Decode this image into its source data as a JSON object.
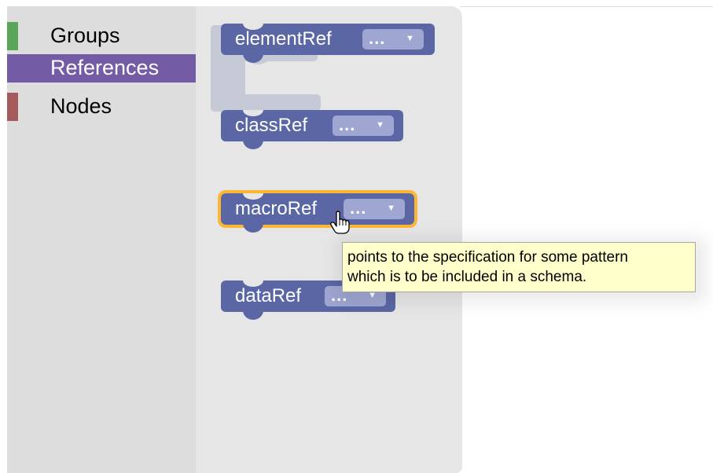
{
  "toolbox": {
    "categories": [
      {
        "label": "Groups",
        "color": "#5ba55b"
      },
      {
        "label": "References",
        "color": "#745ba5"
      },
      {
        "label": "Nodes",
        "color": "#a55b5b"
      }
    ],
    "selected": "References"
  },
  "flyout": {
    "blocks": [
      {
        "name": "elementRef",
        "value": "...",
        "dropdown_icon": "triangle-down-icon",
        "color": "#5b67a5"
      },
      {
        "name": "classRef",
        "value": "...",
        "dropdown_icon": "triangle-down-icon",
        "color": "#5b67a5"
      },
      {
        "name": "macroRef",
        "value": "...",
        "dropdown_icon": "triangle-down-icon",
        "color": "#5b67a5",
        "highlight": "#fbb732"
      },
      {
        "name": "dataRef",
        "value": "...",
        "dropdown_icon": "triangle-down-icon",
        "color": "#5b67a5"
      }
    ]
  },
  "tooltip": {
    "lines": [
      "points to the specification for some pattern",
      "which is to be included in a schema."
    ]
  },
  "cursor": {
    "icon": "hand-pointer-icon"
  }
}
